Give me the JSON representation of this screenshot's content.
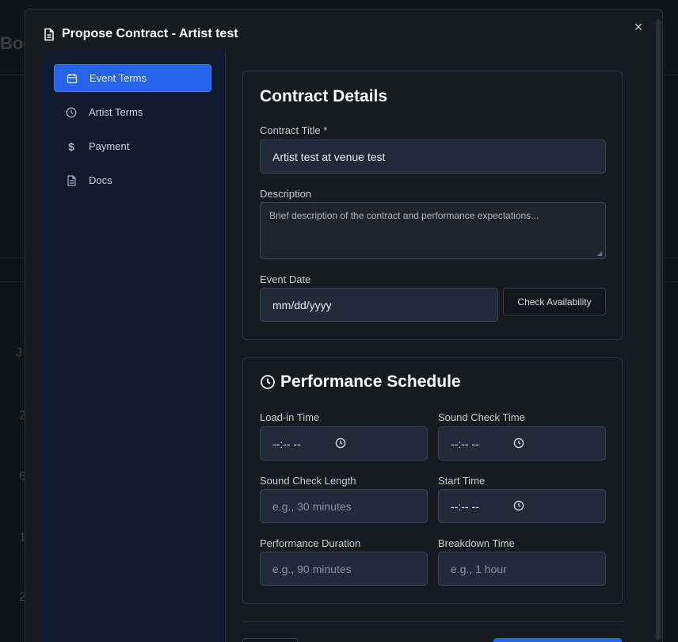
{
  "background": {
    "title_fragment": "Boo",
    "letter_j": "J",
    "row_glyphs": [
      "2",
      "6",
      "1",
      "2"
    ]
  },
  "modal": {
    "title": "Propose Contract - Artist test",
    "close_label": "×"
  },
  "sidebar": {
    "items": [
      {
        "label": "Event Terms",
        "icon": "calendar-icon",
        "active": true
      },
      {
        "label": "Artist Terms",
        "icon": "clock-icon",
        "active": false
      },
      {
        "label": "Payment",
        "icon": "dollar-icon",
        "active": false
      },
      {
        "label": "Docs",
        "icon": "document-icon",
        "active": false
      }
    ]
  },
  "contract_details": {
    "heading": "Contract Details",
    "title_label": "Contract Title *",
    "title_value": "Artist test at venue test",
    "description_label": "Description",
    "description_placeholder": "Brief description of the contract and performance expectations...",
    "event_date_label": "Event Date",
    "event_date_placeholder": "mm/dd/yyyy",
    "check_availability_label": "Check Availability"
  },
  "performance_schedule": {
    "heading": "Performance Schedule",
    "load_in_label": "Load-in Time",
    "load_in_value": "--:-- --",
    "sound_check_time_label": "Sound Check Time",
    "sound_check_time_value": "--:-- --",
    "sound_check_length_label": "Sound Check Length",
    "sound_check_length_placeholder": "e.g., 30 minutes",
    "start_time_label": "Start Time",
    "start_time_value": "--:-- --",
    "performance_duration_label": "Performance Duration",
    "performance_duration_placeholder": "e.g., 90 minutes",
    "breakdown_time_label": "Breakdown Time",
    "breakdown_time_placeholder": "e.g., 1 hour"
  },
  "colors": {
    "accent": "#2563eb",
    "sidebar_bg": "#0f1a2e",
    "modal_bg": "#161a21",
    "input_bg": "#222a3a"
  }
}
